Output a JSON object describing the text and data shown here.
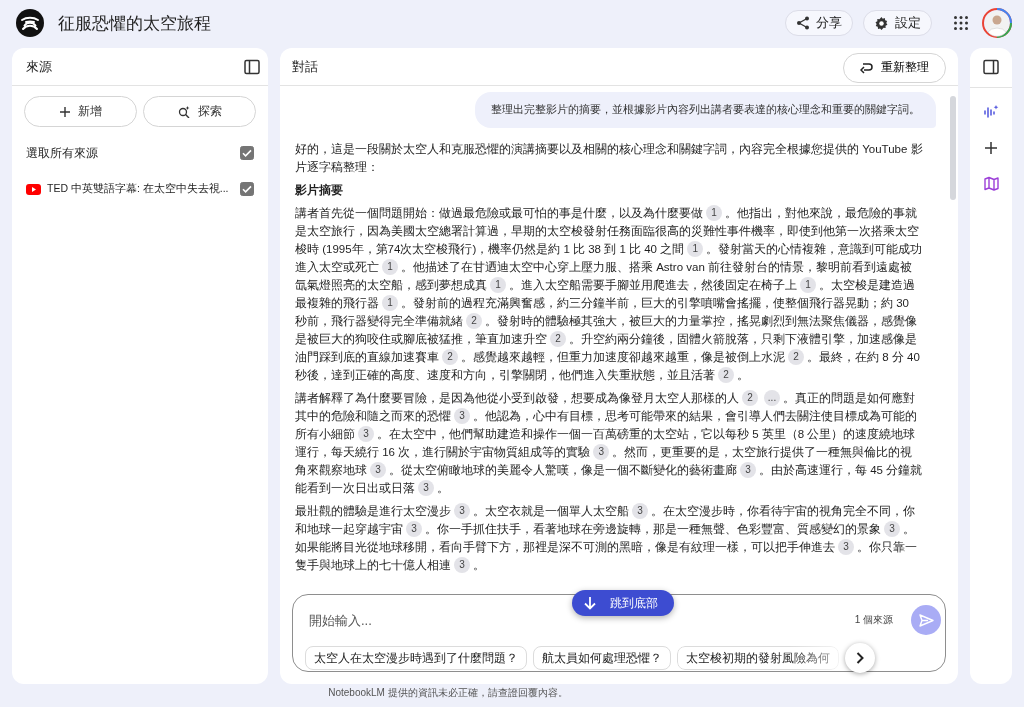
{
  "app": {
    "title": "征服恐懼的太空旅程",
    "actions": [
      {
        "kind": "share",
        "label": "分享"
      },
      {
        "kind": "settings",
        "label": "設定"
      }
    ]
  },
  "sources_panel": {
    "title": "來源",
    "buttons": [
      {
        "kind": "add",
        "label": "新增"
      },
      {
        "kind": "explore",
        "label": "探索"
      }
    ],
    "select_all": {
      "label": "選取所有來源",
      "checked": true
    },
    "items": [
      {
        "kind": "youtube",
        "title": "TED 中英雙語字幕: 在太空中失去視...",
        "checked": true
      }
    ]
  },
  "chat": {
    "title": "對話",
    "refresh_button": "重新整理",
    "user_message": "整理出完整影片的摘要，並根據影片內容列出講者要表達的核心理念和重要的關鍵字詞。",
    "response": [
      {
        "kind": "paragraph",
        "segments": [
          {
            "kind": "text",
            "text": "好的，這是一段關於太空人和克服恐懼的演講摘要以及相關的核心理念和關鍵字詞，內容完全根據您提供的 YouTube 影片逐字稿整理："
          }
        ]
      },
      {
        "kind": "heading",
        "text": "影片摘要"
      },
      {
        "kind": "paragraph",
        "segments": [
          {
            "kind": "text",
            "text": "講者首先從一個問題開始：做過最危險或最可怕的事是什麼，以及為什麼要做"
          },
          {
            "kind": "cite",
            "text": "1"
          },
          {
            "kind": "text",
            "text": "。他指出，對他來說，最危險的事就是太空旅行，因為美國太空總署計算過，早期的太空梭發射任務面臨很高的災難性事件機率，即使到他第一次搭乘太空梭時 (1995年，第74次太空梭飛行)，機率仍然是約 1 比 38 到 1 比 40 之間"
          },
          {
            "kind": "cite",
            "text": "1"
          },
          {
            "kind": "text",
            "text": "。發射當天的心情複雜，意識到可能成功進入太空或死亡"
          },
          {
            "kind": "cite",
            "text": "1"
          },
          {
            "kind": "text",
            "text": "。他描述了在甘迺迪太空中心穿上壓力服、搭乘 Astro van 前往發射台的情景，黎明前看到遠處被氙氣燈照亮的太空船，感到夢想成真"
          },
          {
            "kind": "cite",
            "text": "1"
          },
          {
            "kind": "text",
            "text": "。進入太空船需要手腳並用爬進去，然後固定在椅子上"
          },
          {
            "kind": "cite",
            "text": "1"
          },
          {
            "kind": "text",
            "text": "。太空梭是建造過最複雜的飛行器"
          },
          {
            "kind": "cite",
            "text": "1"
          },
          {
            "kind": "text",
            "text": "。發射前的過程充滿興奮感，約三分鐘半前，巨大的引擎噴嘴會搖擺，使整個飛行器晃動；約 30 秒前，飛行器變得完全準備就緒"
          },
          {
            "kind": "cite",
            "text": "2"
          },
          {
            "kind": "text",
            "text": "。發射時的體驗極其強大，被巨大的力量掌控，搖晃劇烈到無法聚焦儀器，感覺像是被巨大的狗咬住或腳底被猛推，筆直加速升空"
          },
          {
            "kind": "cite",
            "text": "2"
          },
          {
            "kind": "text",
            "text": "。升空約兩分鐘後，固體火箭脫落，只剩下液體引擎，加速感像是油門踩到底的直線加速賽車"
          },
          {
            "kind": "cite",
            "text": "2"
          },
          {
            "kind": "text",
            "text": "。感覺越來越輕，但重力加速度卻越來越重，像是被倒上水泥"
          },
          {
            "kind": "cite",
            "text": "2"
          },
          {
            "kind": "text",
            "text": "。最終，在約 8 分 40 秒後，達到正確的高度、速度和方向，引擎關閉，他們進入失重狀態，並且活著"
          },
          {
            "kind": "cite",
            "text": "2"
          },
          {
            "kind": "text",
            "text": "。"
          }
        ]
      },
      {
        "kind": "paragraph",
        "segments": [
          {
            "kind": "text",
            "text": "講者解釋了為什麼要冒險，是因為他從小受到啟發，想要成為像登月太空人那樣的人"
          },
          {
            "kind": "cite",
            "text": "2"
          },
          {
            "kind": "cite",
            "text": "..."
          },
          {
            "kind": "text",
            "text": "。真正的問題是如何應對其中的危險和隨之而來的恐懼"
          },
          {
            "kind": "cite",
            "text": "3"
          },
          {
            "kind": "text",
            "text": "。他認為，心中有目標，思考可能帶來的結果，會引導人們去關注使目標成為可能的所有小細節"
          },
          {
            "kind": "cite",
            "text": "3"
          },
          {
            "kind": "text",
            "text": "。在太空中，他們幫助建造和操作一個一百萬磅重的太空站，它以每秒 5 英里（8 公里）的速度繞地球運行，每天繞行 16 次，進行關於宇宙物質組成等的實驗"
          },
          {
            "kind": "cite",
            "text": "3"
          },
          {
            "kind": "text",
            "text": "。然而，更重要的是，太空旅行提供了一種無與倫比的視角來觀察地球"
          },
          {
            "kind": "cite",
            "text": "3"
          },
          {
            "kind": "text",
            "text": "。從太空俯瞰地球的美麗令人驚嘆，像是一個不斷變化的藝術畫廊"
          },
          {
            "kind": "cite",
            "text": "3"
          },
          {
            "kind": "text",
            "text": "。由於高速運行，每 45 分鐘就能看到一次日出或日落"
          },
          {
            "kind": "cite",
            "text": "3"
          },
          {
            "kind": "text",
            "text": "。"
          }
        ]
      },
      {
        "kind": "paragraph",
        "segments": [
          {
            "kind": "text",
            "text": "最壯觀的體驗是進行太空漫步"
          },
          {
            "kind": "cite",
            "text": "3"
          },
          {
            "kind": "text",
            "text": "。太空衣就是一個單人太空船"
          },
          {
            "kind": "cite",
            "text": "3"
          },
          {
            "kind": "text",
            "text": "。在太空漫步時，你看待宇宙的視角完全不同，你和地球一起穿越宇宙"
          },
          {
            "kind": "cite",
            "text": "3"
          },
          {
            "kind": "text",
            "text": "。你一手抓住扶手，看著地球在旁邊旋轉，那是一種無聲、色彩豐富、質感變幻的景象"
          },
          {
            "kind": "cite",
            "text": "3"
          },
          {
            "kind": "text",
            "text": "。如果能將目光從地球移開，看向手臂下方，那裡是深不可測的黑暗，像是有紋理一樣，可以把手伸進去"
          },
          {
            "kind": "cite",
            "text": "3"
          },
          {
            "kind": "text",
            "text": "。你只靠一隻手與地球上的七十億人相連"
          },
          {
            "kind": "cite",
            "text": "3"
          },
          {
            "kind": "text",
            "text": "。"
          }
        ]
      }
    ],
    "jump_button": "跳到底部",
    "input": {
      "placeholder": "開始輸入...",
      "source_count": "1 個來源"
    },
    "suggestions": [
      "太空人在太空漫步時遇到了什麼問題？",
      "航太員如何處理恐懼？",
      "太空梭初期的發射風險為何"
    ]
  },
  "footer": "NotebookLM 提供的資訊未必正確，請查證回覆內容。"
}
